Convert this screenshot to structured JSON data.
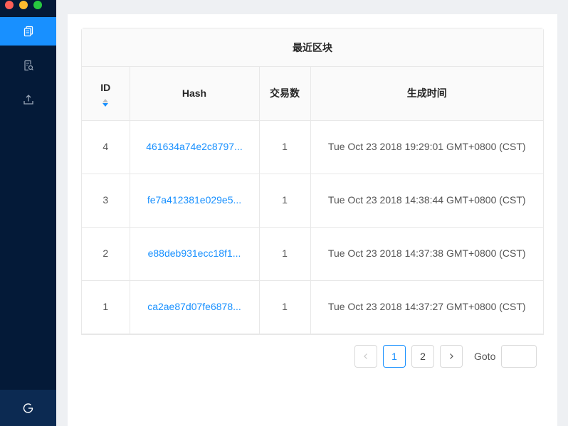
{
  "window": {
    "controls": [
      "close",
      "minimize",
      "maximize"
    ]
  },
  "sidebar": {
    "items": [
      {
        "icon": "document-copy-icon",
        "active": true
      },
      {
        "icon": "search-document-icon",
        "active": false
      },
      {
        "icon": "upload-icon",
        "active": false
      }
    ],
    "logout_icon": "logout-icon"
  },
  "table": {
    "title": "最近区块",
    "columns": {
      "id": "ID",
      "hash": "Hash",
      "tx_count": "交易数",
      "time": "生成时间"
    },
    "rows": [
      {
        "id": "4",
        "hash": "461634a74e2c8797...",
        "tx_count": "1",
        "time": "Tue Oct 23 2018 19:29:01 GMT+0800 (CST)"
      },
      {
        "id": "3",
        "hash": "fe7a412381e029e5...",
        "tx_count": "1",
        "time": "Tue Oct 23 2018 14:38:44 GMT+0800 (CST)"
      },
      {
        "id": "2",
        "hash": "e88deb931ecc18f1...",
        "tx_count": "1",
        "time": "Tue Oct 23 2018 14:37:38 GMT+0800 (CST)"
      },
      {
        "id": "1",
        "hash": "ca2ae87d07fe6878...",
        "tx_count": "1",
        "time": "Tue Oct 23 2018 14:37:27 GMT+0800 (CST)"
      }
    ]
  },
  "pagination": {
    "pages": [
      "1",
      "2"
    ],
    "current": "1",
    "prev_icon": "chevron-left-icon",
    "next_icon": "chevron-right-icon",
    "goto_label": "Goto",
    "goto_value": ""
  },
  "colors": {
    "sidebar": "#041a38",
    "accent": "#1890ff",
    "logout_bg": "#0c2a52"
  }
}
